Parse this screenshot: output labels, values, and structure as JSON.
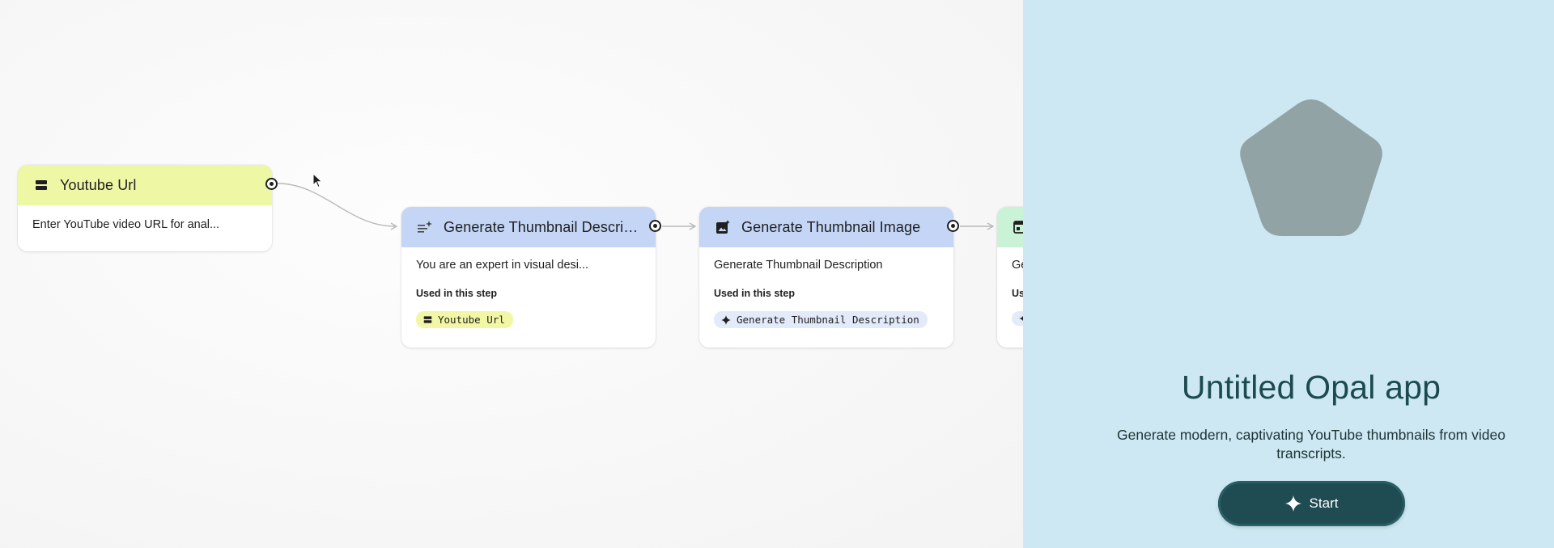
{
  "canvas": {
    "nodes": [
      {
        "title": "Youtube Url",
        "icon": "input-icon",
        "header_color": "#eef7a3",
        "text": "Enter YouTube video URL for anal..."
      },
      {
        "title": "Generate Thumbnail Descript...",
        "icon": "text-generate-icon",
        "header_color": "#c5d5f6",
        "text": "You are an expert in visual desi...",
        "used_label": "Used in this step",
        "chip": "Youtube Url",
        "chip_icon": "input-icon"
      },
      {
        "title": "Generate Thumbnail Image",
        "icon": "image-generate-icon",
        "header_color": "#c5d5f6",
        "text": "Generate Thumbnail Description",
        "used_label": "Used in this step",
        "chip": "Generate Thumbnail Description",
        "chip_icon": "sparkle-icon"
      },
      {
        "title": "",
        "icon": "output-icon",
        "header_color": "#c9f2d6",
        "text": "Ge",
        "used_label": "Use"
      }
    ]
  },
  "preview": {
    "background": "#cde8f2",
    "logo_icon": "pentagon-icon",
    "title": "Untitled Opal app",
    "description": "Generate modern, captivating YouTube thumbnails from video transcripts.",
    "start_label": "Start",
    "start_icon": "sparkle-icon",
    "accent": "#1f4b52"
  }
}
